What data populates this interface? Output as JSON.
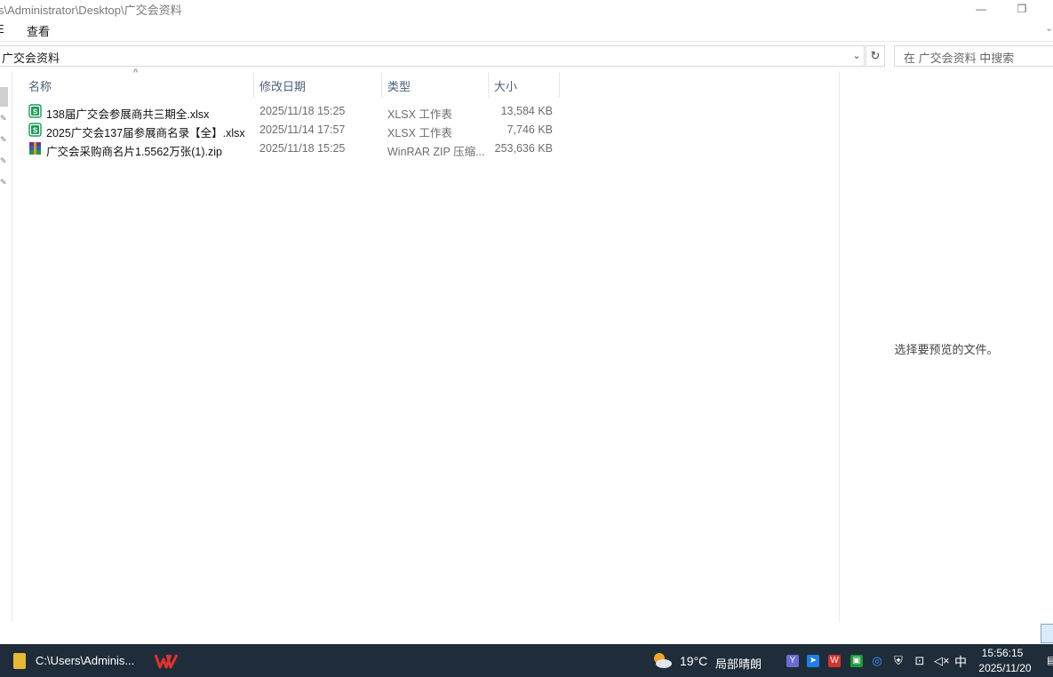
{
  "window": {
    "title": "s\\Administrator\\Desktop\\广交会资料",
    "minimize_glyph": "—",
    "restore_glyph": "❐"
  },
  "ribbon": {
    "file_tab": "E",
    "view_tab": "查看",
    "expand_glyph": "⌄"
  },
  "address": {
    "path": "广交会资料",
    "dropdown_glyph": "⌄",
    "refresh_glyph": "↻"
  },
  "search": {
    "placeholder": "在 广交会资料 中搜索"
  },
  "columns": {
    "name": "名称",
    "modified": "修改日期",
    "type": "类型",
    "size": "大小",
    "sort_glyph": "^"
  },
  "files": [
    {
      "name": "138届广交会参展商共三期全.xlsx",
      "modified": "2025/11/18 15:25",
      "type": "XLSX 工作表",
      "size": "13,584 KB",
      "icon": "xlsx-icon"
    },
    {
      "name": "2025广交会137届参展商名录【全】.xlsx",
      "modified": "2025/11/14 17:57",
      "type": "XLSX 工作表",
      "size": "7,746 KB",
      "icon": "xlsx-icon"
    },
    {
      "name": "广交会采购商名片1.5562万张(1).zip",
      "modified": "2025/11/18 15:25",
      "type": "WinRAR ZIP 压缩...",
      "size": "253,636 KB",
      "icon": "winrar-icon"
    }
  ],
  "preview": {
    "message": "选择要预览的文件。"
  },
  "taskbar": {
    "explorer_label": "C:\\Users\\Adminis...",
    "temperature": "19°C",
    "weather": "局部晴朗",
    "ime": "中",
    "time": "15:56:15",
    "date": "2025/11/20",
    "notify_glyph": "▤"
  },
  "colors": {
    "taskbar_bg": "#1f2d3a",
    "xlsx_green": "#1e9a5a",
    "header_text": "#4c607a"
  }
}
